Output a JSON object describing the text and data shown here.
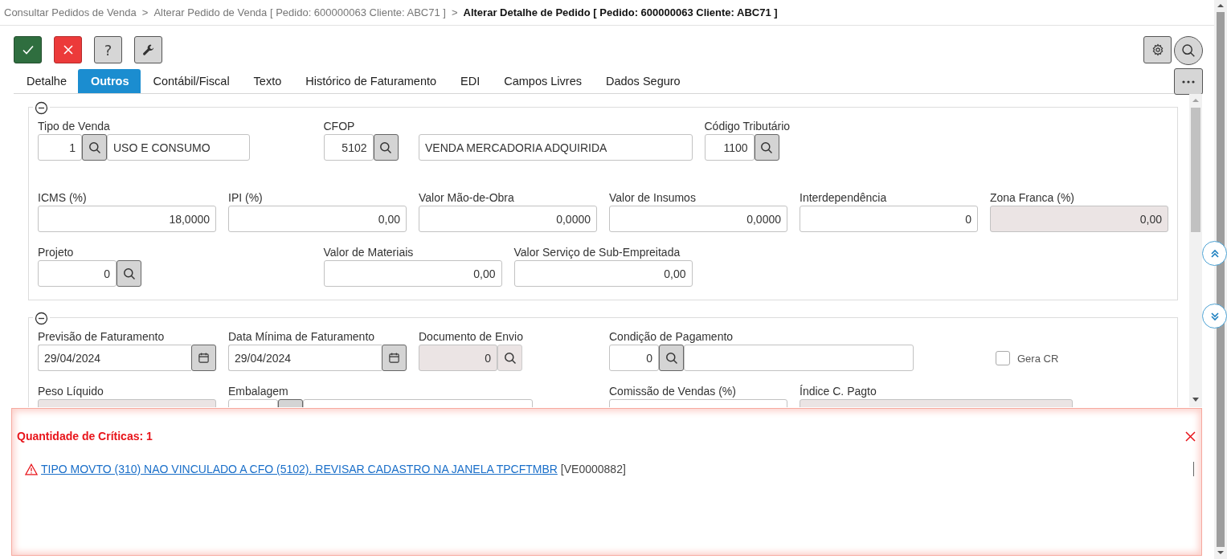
{
  "breadcrumb": [
    {
      "label": "Consultar Pedidos de Venda",
      "current": false,
      "separator": ">"
    },
    {
      "label": "Alterar Pedido de Venda [ Pedido: 600000063 Cliente: ABC71 ]",
      "current": false,
      "separator": ">"
    },
    {
      "label": "Alterar Detalhe de Pedido [ Pedido: 600000063 Cliente: ABC71 ]",
      "current": true
    }
  ],
  "toolbar": [
    {
      "kind": "confirm"
    },
    {
      "kind": "cancel"
    },
    {
      "kind": "help",
      "label": "?"
    },
    {
      "kind": "tools"
    }
  ],
  "tool_actions": [
    {
      "kind": "settings"
    },
    {
      "kind": "search"
    },
    {
      "kind": "more"
    }
  ],
  "tabs": [
    {
      "label": "Detalhe",
      "selected": false
    },
    {
      "label": "Outros",
      "selected": true
    },
    {
      "label": "Contábil/Fiscal",
      "selected": false
    },
    {
      "label": "Texto",
      "selected": false
    },
    {
      "label": "Histórico de Faturamento",
      "selected": false
    },
    {
      "label": "EDI",
      "selected": false
    },
    {
      "label": "Campos Livres",
      "selected": false
    },
    {
      "label": "Dados Seguro",
      "selected": false
    }
  ],
  "sections": [
    {
      "expanded": true,
      "fields": [
        {
          "kind": "lookup",
          "label": "Tipo de Venda",
          "code": "1",
          "description": "USO E CONSUMO",
          "disabled": false
        },
        {
          "kind": "lookup",
          "label": "CFOP",
          "code": "5102",
          "disabled": false
        },
        {
          "kind": "text",
          "value": "VENDA MERCADORIA ADQUIRIDA",
          "disabled": false
        },
        {
          "kind": "lookup",
          "label": "Código Tributário",
          "code": "1100",
          "disabled": false
        },
        {
          "kind": "number",
          "label": "ICMS (%)",
          "value": "18,0000",
          "disabled": false
        },
        {
          "kind": "number",
          "label": "IPI (%)",
          "value": "0,00",
          "disabled": false
        },
        {
          "kind": "number",
          "label": "Valor Mão-de-Obra",
          "value": "0,0000",
          "disabled": false
        },
        {
          "kind": "number",
          "label": "Valor de Insumos",
          "value": "0,0000",
          "disabled": false
        },
        {
          "kind": "number",
          "label": "Interdependência",
          "value": "0",
          "disabled": false
        },
        {
          "kind": "number",
          "label": "Zona Franca (%)",
          "value": "0,00",
          "disabled": true
        },
        {
          "kind": "lookup",
          "label": "Projeto",
          "code": "0",
          "disabled": false
        },
        {
          "kind": "number",
          "label": "Valor de Materiais",
          "value": "0,00",
          "disabled": false
        },
        {
          "kind": "number",
          "label": "Valor Serviço de Sub-Empreitada",
          "value": "0,00",
          "disabled": false
        }
      ]
    },
    {
      "expanded": true,
      "fields": [
        {
          "kind": "date",
          "label": "Previsão de Faturamento",
          "value": "29/04/2024",
          "disabled": false
        },
        {
          "kind": "date",
          "label": "Data Mínima de Faturamento",
          "value": "29/04/2024",
          "disabled": false
        },
        {
          "kind": "lookup",
          "label": "Documento de Envio",
          "code": "0",
          "disabled": true
        },
        {
          "kind": "lookup",
          "label": "Condição de Pagamento",
          "code": "0",
          "disabled": false
        },
        {
          "kind": "checkbox",
          "label": "Gera CR",
          "checked": false
        },
        {
          "kind": "number",
          "label": "Peso Líquido",
          "disabled": true
        },
        {
          "kind": "lookup",
          "label": "Embalagem",
          "disabled": false
        },
        {
          "kind": "number",
          "label": "Comissão de Vendas (%)",
          "disabled": false
        },
        {
          "kind": "text",
          "label": "Índice C. Pagto",
          "disabled": true
        }
      ]
    }
  ],
  "critics": {
    "title": "Quantidade de Críticas: 1",
    "messages": [
      {
        "text": "TIPO MOVTO (310) NAO VINCULADO A CFO (5102). REVISAR CADASTRO NA JANELA TPCFTMBR",
        "code": "[VE0000882]"
      }
    ]
  }
}
